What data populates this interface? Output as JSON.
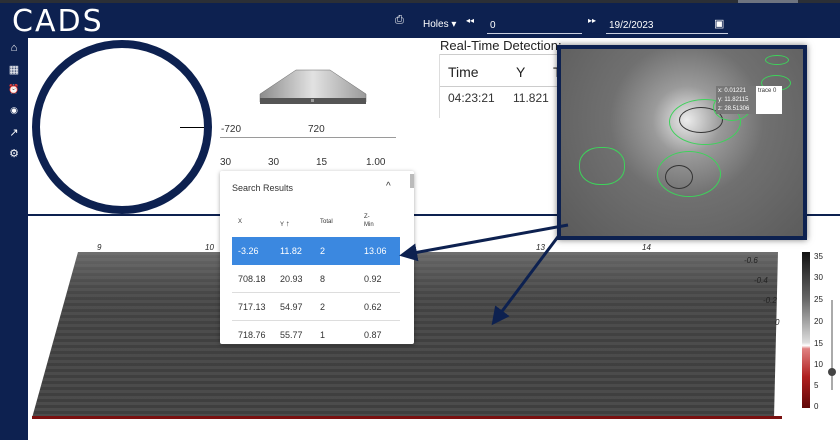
{
  "app": {
    "logo": "CADS"
  },
  "toolbar": {
    "export_icon": "export-icon",
    "filter_label": "Holes",
    "filter_caret": "▾",
    "prev_icon": "rewind-icon",
    "prev_glyph": "◂◂",
    "value": "0",
    "next_icon": "fast-forward-icon",
    "next_glyph": "▸▸",
    "date": "19/2/2023",
    "calendar_icon": "calendar-icon"
  },
  "sidebar": {
    "items": [
      {
        "name": "home-icon",
        "glyph": "⌂"
      },
      {
        "name": "dashboard-icon",
        "glyph": "▦"
      },
      {
        "name": "alarm-icon",
        "glyph": "⏰"
      },
      {
        "name": "signal-icon",
        "glyph": "◉"
      },
      {
        "name": "trend-icon",
        "glyph": "↗"
      },
      {
        "name": "gear-icon",
        "glyph": "⚙"
      }
    ]
  },
  "controls": {
    "range_min": "-720",
    "range_max": "720",
    "params": [
      "30",
      "30",
      "15",
      "1.00"
    ]
  },
  "realtime": {
    "title": "Real-Time Detection:",
    "headers": [
      "Time",
      "Y",
      "T"
    ],
    "row": {
      "time": "04:23:21",
      "y": "11.821"
    }
  },
  "search": {
    "title": "Search Results",
    "collapse_icon": "chevron-up-icon",
    "collapse_glyph": "^",
    "columns": [
      "X",
      "Y",
      "Total",
      "Z-",
      "Min"
    ],
    "sort_glyph": "↑",
    "rows": [
      {
        "x": "-3.26",
        "y": "11.82",
        "total": "2",
        "zmin": "13.06",
        "selected": true
      },
      {
        "x": "708.18",
        "y": "20.93",
        "total": "8",
        "zmin": "0.92"
      },
      {
        "x": "717.13",
        "y": "54.97",
        "total": "2",
        "zmin": "0.62"
      },
      {
        "x": "718.76",
        "y": "55.77",
        "total": "1",
        "zmin": "0.87"
      }
    ]
  },
  "plot": {
    "axis_top": [
      "9",
      "10",
      "13",
      "14"
    ],
    "axis_right": [
      "0.6",
      "0.4",
      "0.2",
      "0"
    ],
    "colorbar_ticks": [
      "35",
      "30",
      "25",
      "20",
      "15",
      "10",
      "5",
      "0"
    ]
  },
  "tooltip": {
    "x": "x: 0.01221",
    "y": "y: 11.82115",
    "z": "z: 28.51306",
    "trace": "trace 0"
  },
  "colors": {
    "navy": "#0d2150",
    "selected": "#3b88e0",
    "contour": "#3ed25b"
  }
}
